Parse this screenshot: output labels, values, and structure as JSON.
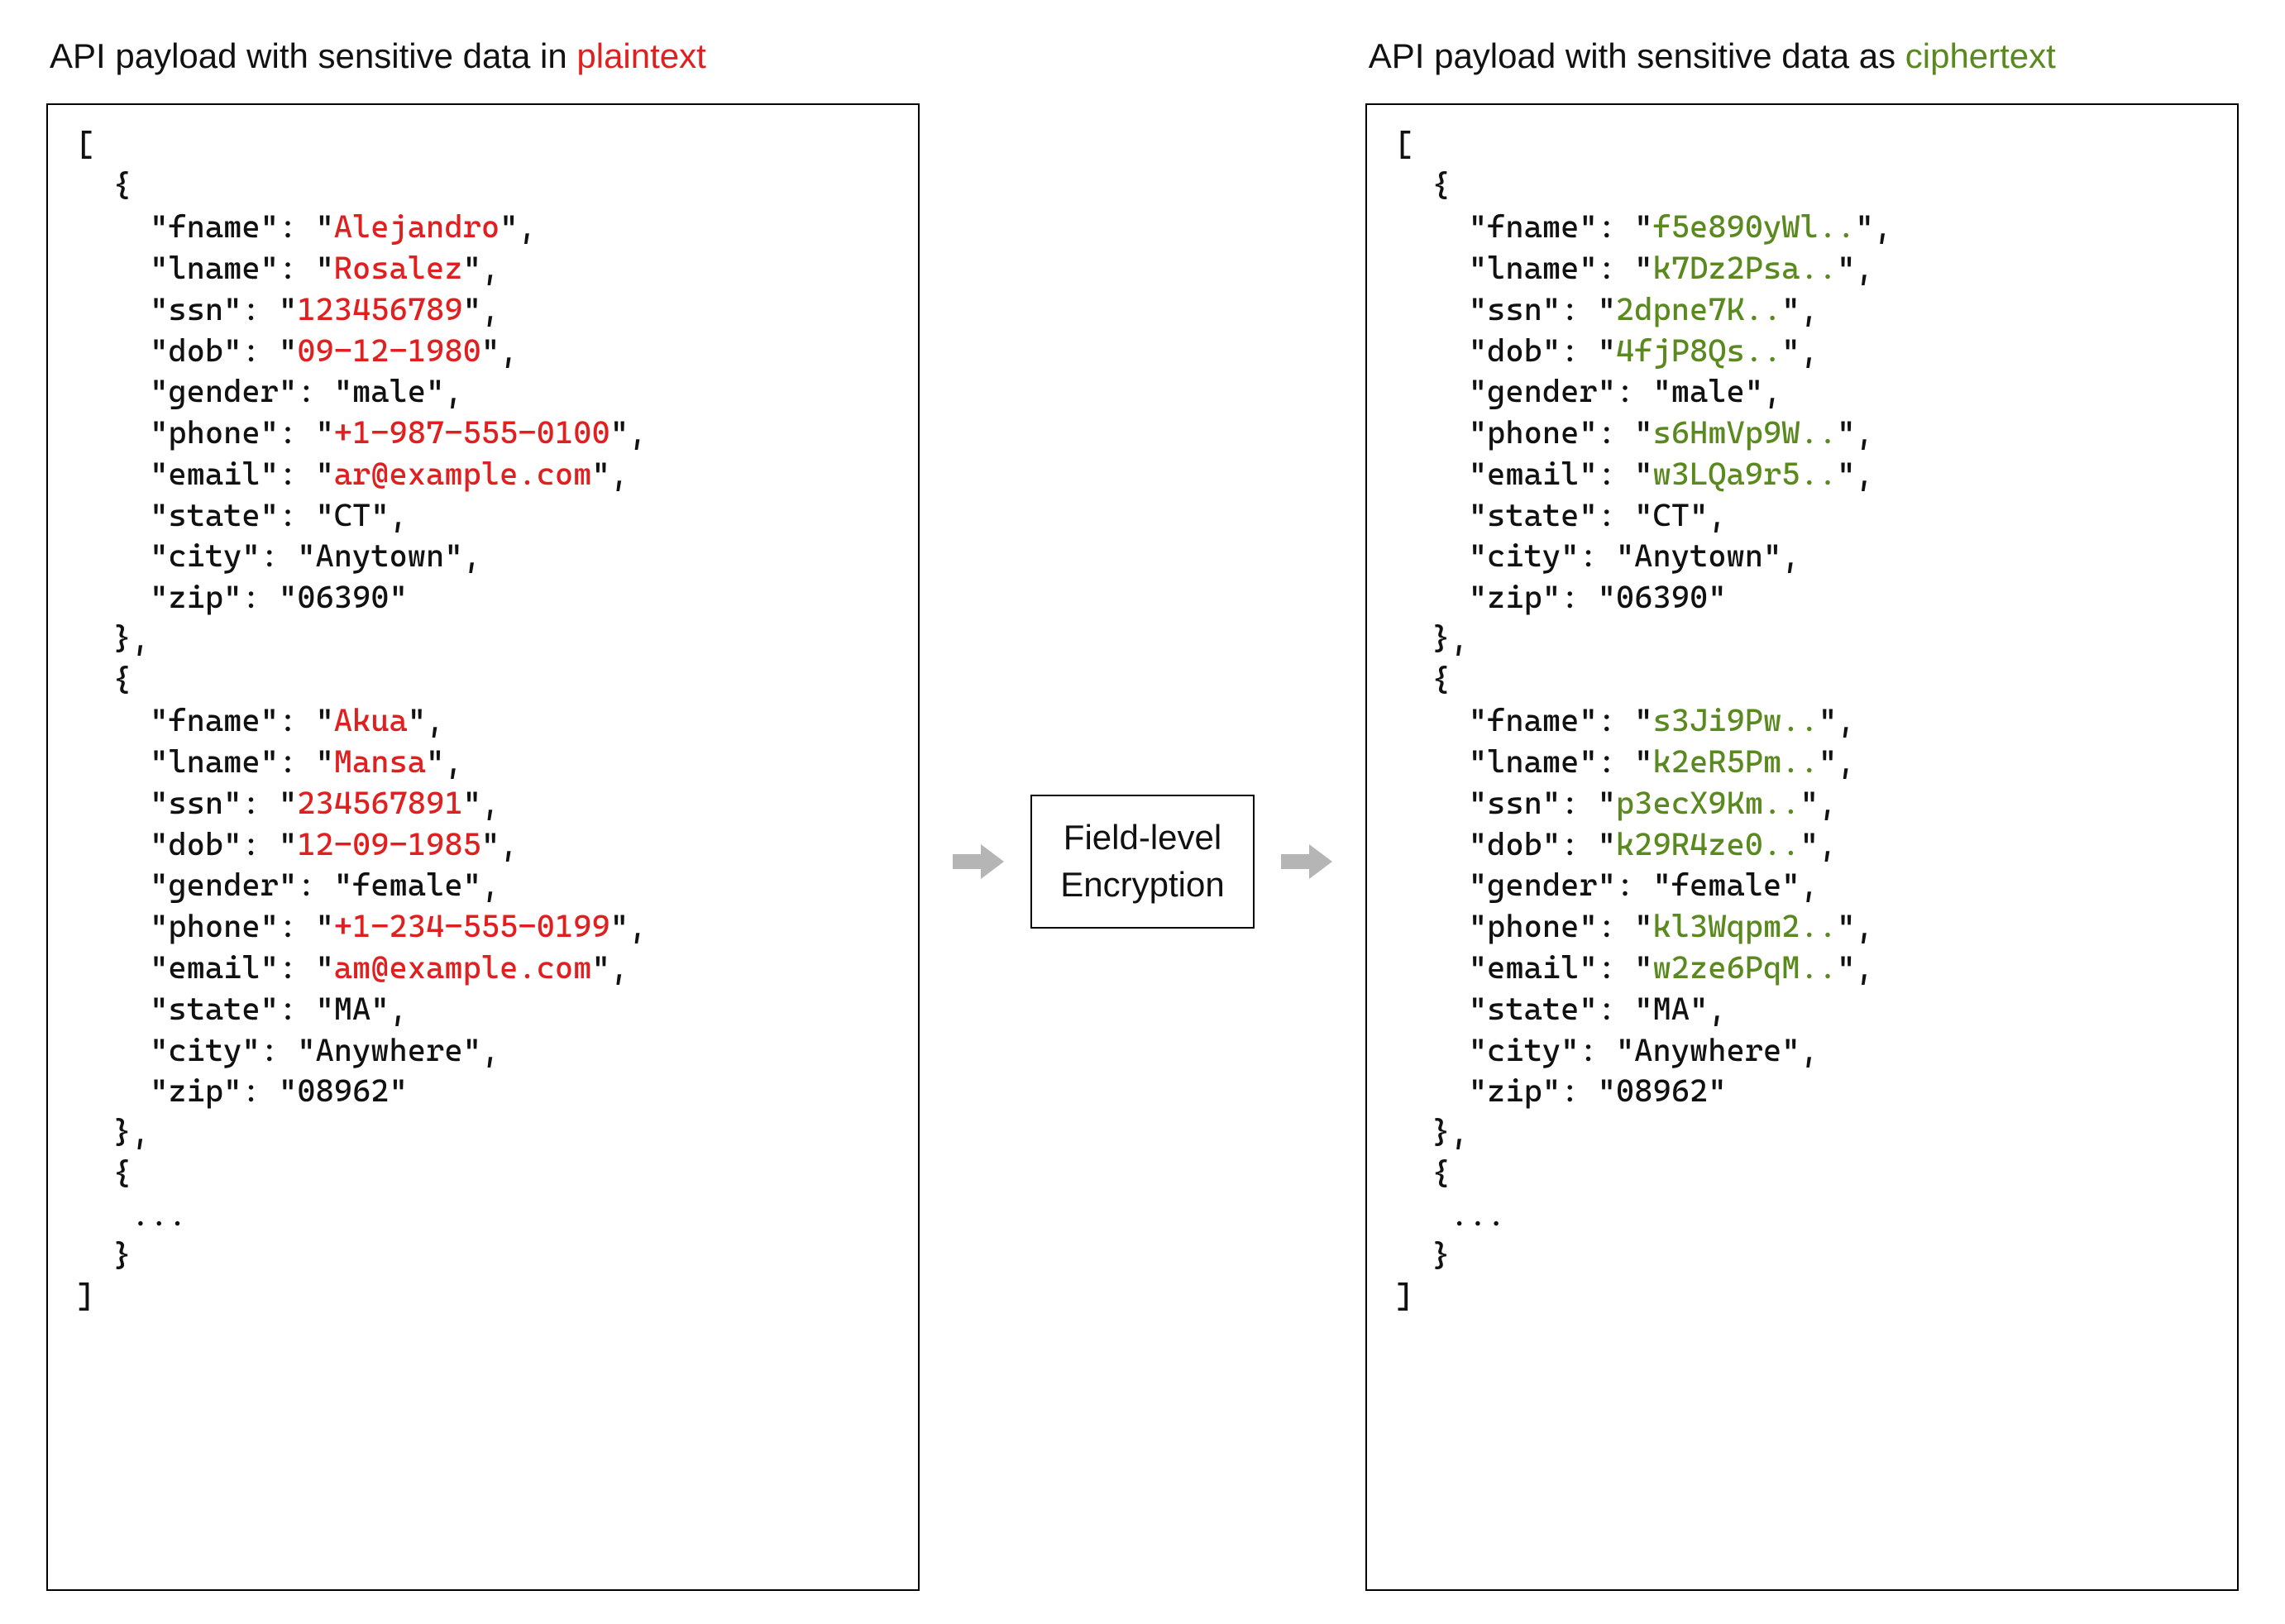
{
  "headings": {
    "left_prefix": "API payload with sensitive data in ",
    "left_highlight": "plaintext",
    "right_prefix": "API payload with sensitive data as ",
    "right_highlight": "ciphertext"
  },
  "mid_box": {
    "line1": "Field-level",
    "line2": "Encryption"
  },
  "sensitive_fields": [
    "fname",
    "lname",
    "ssn",
    "dob",
    "phone",
    "email"
  ],
  "payload_left": [
    {
      "fname": "Alejandro",
      "lname": "Rosalez",
      "ssn": "123456789",
      "dob": "09-12-1980",
      "gender": "male",
      "phone": "+1-987-555-0100",
      "email": "ar@example.com",
      "state": "CT",
      "city": "Anytown",
      "zip": "06390"
    },
    {
      "fname": "Akua",
      "lname": "Mansa",
      "ssn": "234567891",
      "dob": "12-09-1985",
      "gender": "female",
      "phone": "+1-234-555-0199",
      "email": "am@example.com",
      "state": "MA",
      "city": "Anywhere",
      "zip": "08962"
    }
  ],
  "payload_right": [
    {
      "fname": "f5e890yWl..",
      "lname": "k7Dz2Psa..",
      "ssn": "2dpne7K..",
      "dob": "4fjP8Qs..",
      "gender": "male",
      "phone": "s6HmVp9W..",
      "email": "w3LQa9r5..",
      "state": "CT",
      "city": "Anytown",
      "zip": "06390"
    },
    {
      "fname": "s3Ji9Pw..",
      "lname": "k2eR5Pm..",
      "ssn": "p3ecX9Km..",
      "dob": "k29R4ze0..",
      "gender": "female",
      "phone": "kl3Wqpm2..",
      "email": "w2ze6PqM..",
      "state": "MA",
      "city": "Anywhere",
      "zip": "08962"
    }
  ],
  "field_order": [
    "fname",
    "lname",
    "ssn",
    "dob",
    "gender",
    "phone",
    "email",
    "state",
    "city",
    "zip"
  ],
  "ellipsis_token": "..."
}
